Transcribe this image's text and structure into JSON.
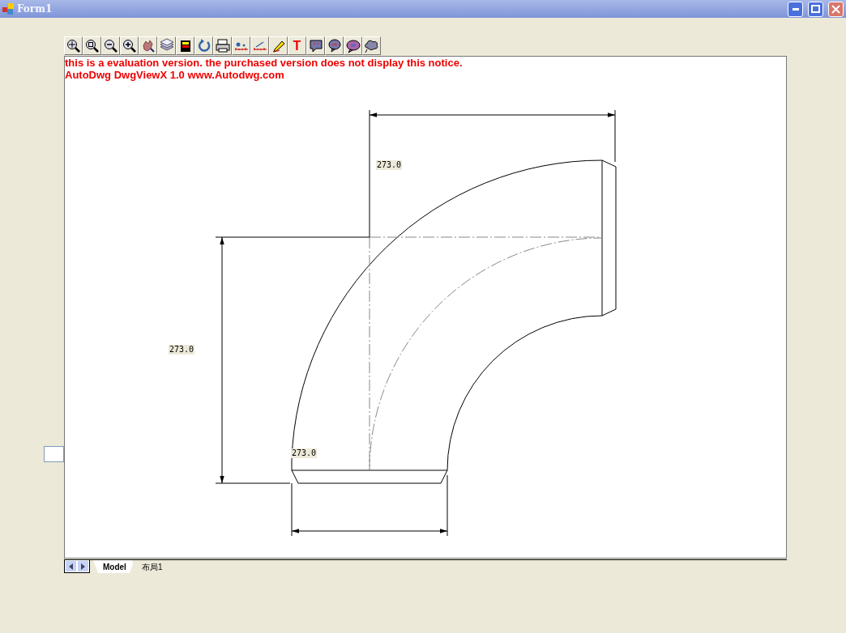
{
  "window": {
    "title": "Form1"
  },
  "toolbar": [
    {
      "kind": "zoom-extents"
    },
    {
      "kind": "zoom-window"
    },
    {
      "kind": "zoom-out"
    },
    {
      "kind": "zoom-in"
    },
    {
      "kind": "pan"
    },
    {
      "kind": "layers"
    },
    {
      "kind": "layer-color"
    },
    {
      "kind": "refresh"
    },
    {
      "kind": "print"
    },
    {
      "kind": "measure"
    },
    {
      "kind": "measure-angle"
    },
    {
      "kind": "pencil"
    },
    {
      "kind": "text",
      "label": "T"
    },
    {
      "kind": "comment-square"
    },
    {
      "kind": "comment-red"
    },
    {
      "kind": "comment-purple"
    },
    {
      "kind": "comment-cloud"
    }
  ],
  "notice": [
    "this is a evaluation version. the purchased version does not display this notice.",
    "AutoDwg DwgViewX 1.0 www.Autodwg.com"
  ],
  "dimension_labels": [
    "273.0",
    "273.0",
    "273.0"
  ],
  "layout_tabs": [
    {
      "label": "Model",
      "selected": true
    },
    {
      "label": "布局1",
      "selected": false
    }
  ]
}
